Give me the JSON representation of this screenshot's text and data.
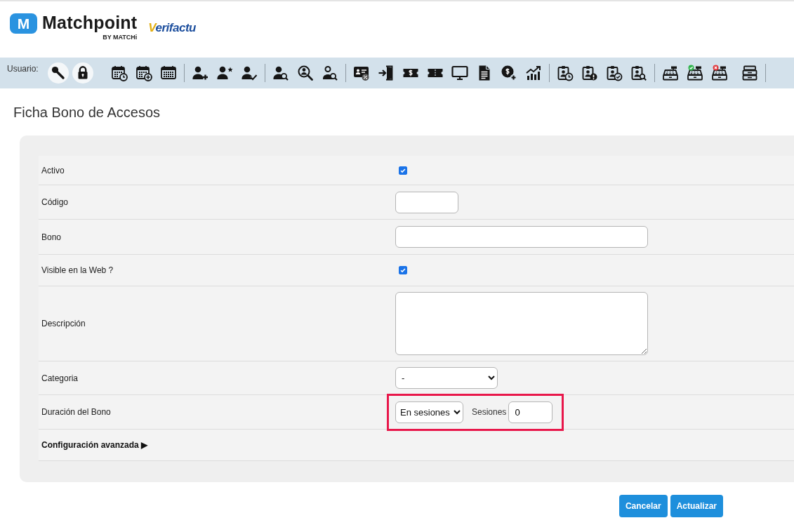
{
  "header": {
    "logo_mark": "M",
    "logo_name": "Matchpoint",
    "logo_byline": "BY MATCHi",
    "verifactu_logo": "Verifactu"
  },
  "toolbar": {
    "user_label": "Usuario:"
  },
  "page_title": "Ficha Bono de Accesos",
  "form": {
    "rows": [
      {
        "kind": "checkbox",
        "label": "Activo",
        "checked": true
      },
      {
        "kind": "short-text",
        "label": "Código"
      },
      {
        "kind": "text",
        "label": "Bono"
      },
      {
        "kind": "checkbox",
        "label": "Visible en la Web ?",
        "checked": true
      },
      {
        "kind": "textarea",
        "label": "Descripción"
      },
      {
        "kind": "select",
        "label": "Categoria",
        "value": "-"
      },
      {
        "kind": "duration",
        "label": "Duración del Bono",
        "value": "En sesiones",
        "sessions_label": "Sesiones",
        "sessions_value": "0",
        "highlighted": true
      },
      {
        "kind": "toggle",
        "label": "Configuración avanzada ▶"
      }
    ]
  },
  "buttons": [
    {
      "label": "Cancelar"
    },
    {
      "label": "Actualizar"
    }
  ]
}
